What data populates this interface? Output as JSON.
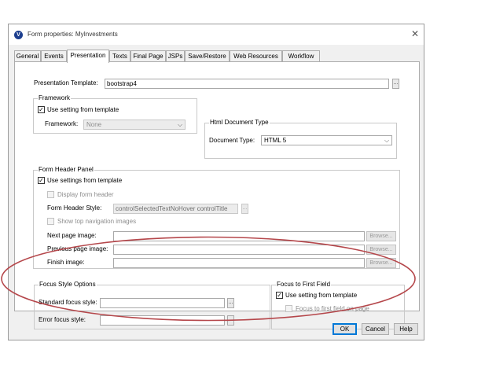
{
  "window": {
    "title": "Form properties: MyInvestments",
    "app_icon": "V"
  },
  "tabs": [
    {
      "label": "General"
    },
    {
      "label": "Events"
    },
    {
      "label": "Presentation",
      "active": true
    },
    {
      "label": "Texts"
    },
    {
      "label": "Final Page"
    },
    {
      "label": "JSPs"
    },
    {
      "label": "Save/Restore"
    },
    {
      "label": "Web Resources"
    },
    {
      "label": "Workflow"
    }
  ],
  "presentation_template": {
    "label": "Presentation Template:",
    "value": "bootstrap4",
    "dots": "..."
  },
  "framework": {
    "title": "Framework",
    "use_setting_label": "Use setting from template",
    "use_setting_checked": true,
    "framework_label": "Framework:",
    "framework_value": "None"
  },
  "html_doc_type": {
    "title": "Html Document Type",
    "label": "Document Type:",
    "value": "HTML 5"
  },
  "form_header": {
    "title": "Form Header Panel",
    "use_settings_label": "Use settings from template",
    "use_settings_checked": true,
    "display_header_label": "Display form header",
    "header_style_label": "Form Header Style:",
    "header_style_value": "controlSelectedTextNoHover controlTitle",
    "dots": "...",
    "show_nav_label": "Show top navigation images",
    "next_label": "Next page image:",
    "previous_label": "Previous page image:",
    "finish_label": "Finish image:",
    "browse": "Browse..."
  },
  "focus_style": {
    "title": "Focus Style Options",
    "standard_label": "Standard focus style:",
    "error_label": "Error focus style:",
    "dots": "..."
  },
  "focus_first": {
    "title": "Focus to First Field",
    "use_setting_label": "Use setting from template",
    "use_setting_checked": true,
    "focus_first_label": "Focus to first field on page"
  },
  "buttons": {
    "ok": "OK",
    "cancel": "Cancel",
    "help": "Help"
  },
  "colors": {
    "annotation": "#b5474b",
    "default_button_border": "#0078d7"
  }
}
